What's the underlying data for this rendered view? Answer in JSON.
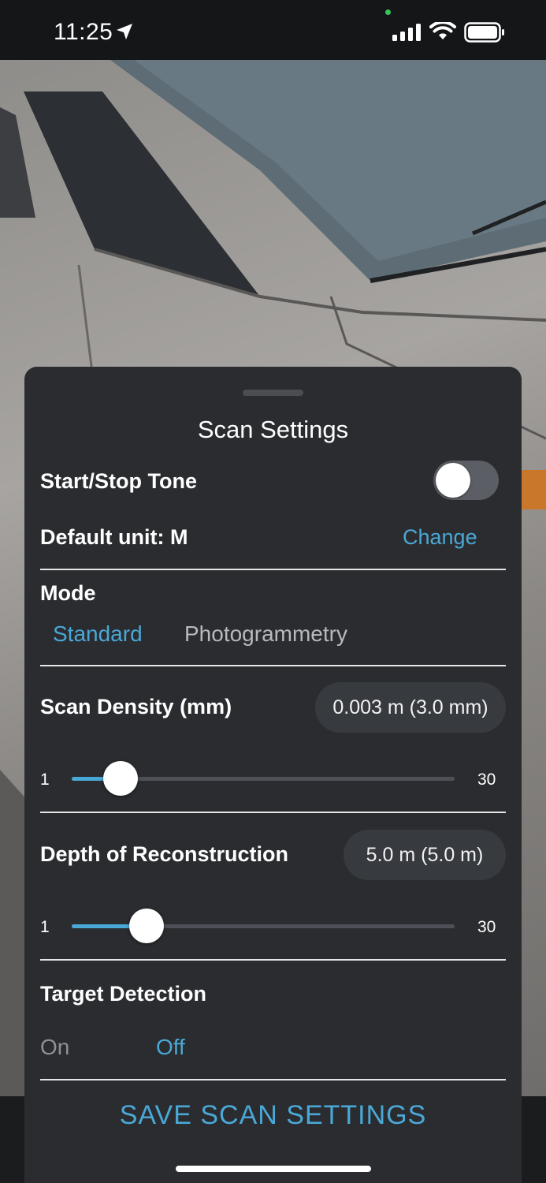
{
  "status_bar": {
    "time": "11:25"
  },
  "sheet": {
    "title": "Scan Settings",
    "start_stop_tone": {
      "label": "Start/Stop Tone",
      "enabled": false
    },
    "default_unit": {
      "label": "Default unit: M",
      "change_label": "Change"
    },
    "mode": {
      "label": "Mode",
      "options": [
        "Standard",
        "Photogrammetry"
      ],
      "selected": "Standard"
    },
    "scan_density": {
      "label": "Scan Density (mm)",
      "value_text": "0.003 m (3.0 mm)",
      "min": "1",
      "max": "30",
      "value": 3
    },
    "depth_of_reconstruction": {
      "label": "Depth of Reconstruction",
      "value_text": "5.0 m (5.0 m)",
      "min": "1",
      "max": "30",
      "value": 5
    },
    "target_detection": {
      "label": "Target Detection",
      "on_label": "On",
      "off_label": "Off",
      "selected": "Off"
    },
    "save_label": "SAVE SCAN SETTINGS"
  },
  "colors": {
    "accent": "#4aa8d6",
    "sheet_background": "#2a2c30",
    "toggle_off": "#5b5e64"
  }
}
